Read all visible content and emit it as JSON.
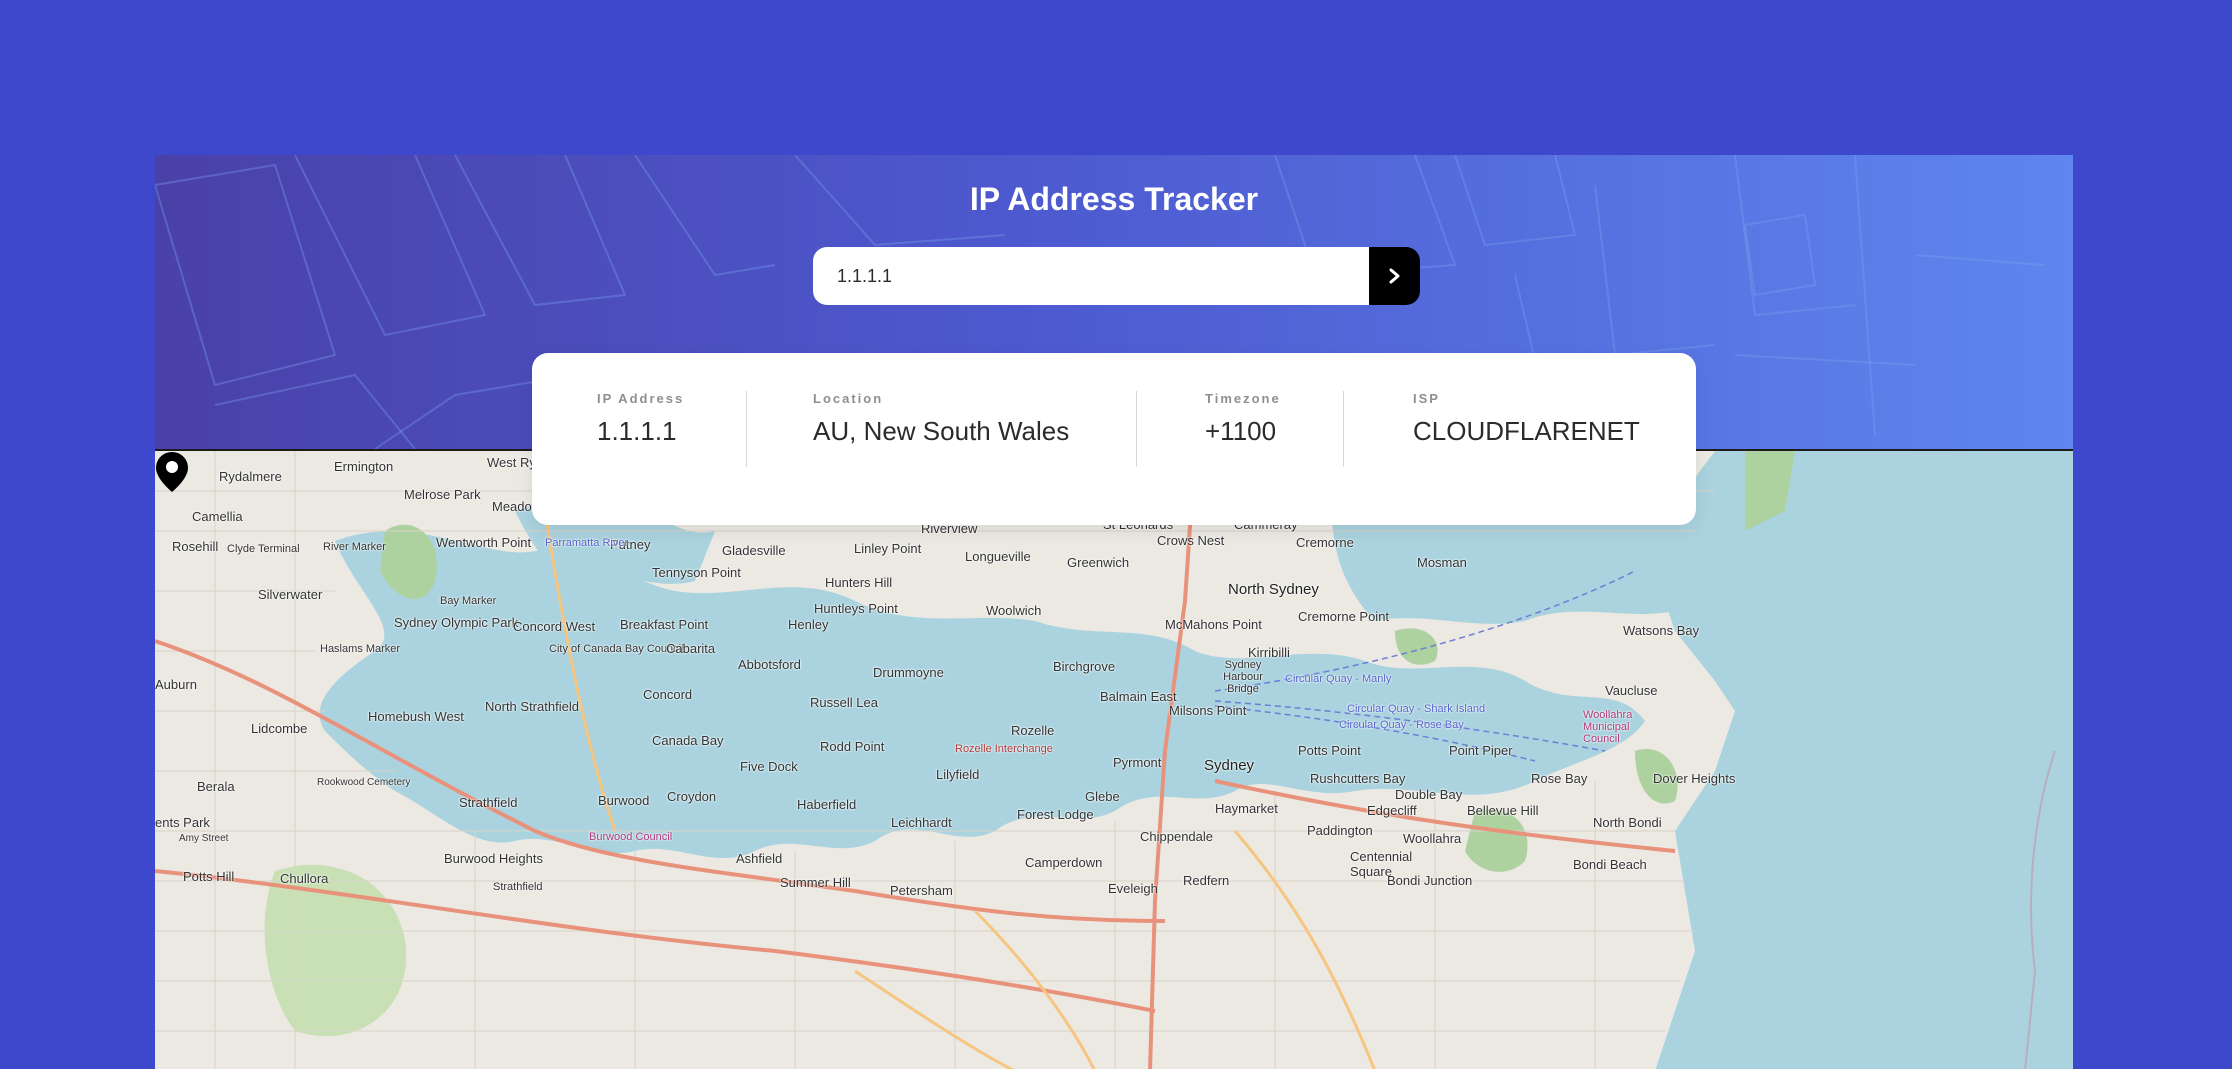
{
  "header": {
    "title": "IP Address Tracker"
  },
  "search": {
    "value": "1.1.1.1",
    "button_icon": "chevron-right-icon"
  },
  "info": [
    {
      "label": "IP Address",
      "value": "1.1.1.1"
    },
    {
      "label": "Location",
      "value": "AU, New South Wales"
    },
    {
      "label": "Timezone",
      "value": "+1100"
    },
    {
      "label": "ISP",
      "value": "CLOUDFLARENET"
    }
  ],
  "map": {
    "marker_icon": "location-pin-icon",
    "labels": [
      "Ermington",
      "West Ryde",
      "Rydalmere",
      "Melrose Park",
      "Meadowbank",
      "Camellia",
      "Rosehill",
      "Clyde Terminal",
      "River Marker",
      "Wentworth Point",
      "Silverwater",
      "Sydney Olympic Park",
      "Bay Marker",
      "Haslams Marker",
      "Concord West",
      "Breakfast Point",
      "City of Canada Bay Council",
      "Cabarita",
      "Putney",
      "Gladesville",
      "Tennyson Point",
      "Linley Point",
      "Hunters Hill",
      "Riverview",
      "Longueville",
      "St Leonards",
      "Crows Nest",
      "Cammeray",
      "Cremorne",
      "Greenwich",
      "Mosman",
      "North Sydney",
      "Cremorne Point",
      "Huntleys Point",
      "Henley",
      "Woolwich",
      "McMahons Point",
      "Kirribilli",
      "Abbotsford",
      "Drummoyne",
      "Birchgrove",
      "Sydney Harbour Bridge",
      "Balmain East",
      "Milsons Point",
      "Circular Quay - Manly",
      "Circular Quay - Shark Island",
      "Circular Quay - Rose Bay",
      "Watsons Bay",
      "Vaucluse",
      "Woollahra Municipal Council",
      "Concord",
      "North Strathfield",
      "Russell Lea",
      "Rozelle",
      "Canada Bay",
      "Rodd Point",
      "Five Dock",
      "Lilyfield",
      "Pyrmont",
      "Sydney",
      "Potts Point",
      "Point Piper",
      "Rose Bay",
      "Dover Heights",
      "Lidcombe",
      "Homebush West",
      "Berala",
      "Rookwood Cemetery",
      "Strathfield",
      "Burwood",
      "Croydon",
      "Haberfield",
      "Leichhardt",
      "Forest Lodge",
      "Glebe",
      "Haymarket",
      "Rushcutters Bay",
      "Double Bay",
      "Edgecliff",
      "Bellevue Hill",
      "North Bondi",
      "Paddington",
      "Woollahra",
      "Chippendale",
      "Centennial Square",
      "Bondi Beach",
      "Burwood Heights",
      "Ashfield",
      "Summer Hill",
      "Camperdown",
      "Redfern",
      "Bondi Junction",
      "Potts Hill",
      "Chullora",
      "Auburn",
      "Strathfield",
      "Petersham",
      "Eveleigh",
      "ents Park",
      "Amy Street",
      "Burwood Council",
      "Rozelle Interchange",
      "Parramatta River",
      "Wentworth Point"
    ]
  },
  "colors": {
    "background": "#3e48cc",
    "button": "#000000",
    "card": "#ffffff",
    "water": "#aad3df",
    "land": "#f2efe9"
  }
}
